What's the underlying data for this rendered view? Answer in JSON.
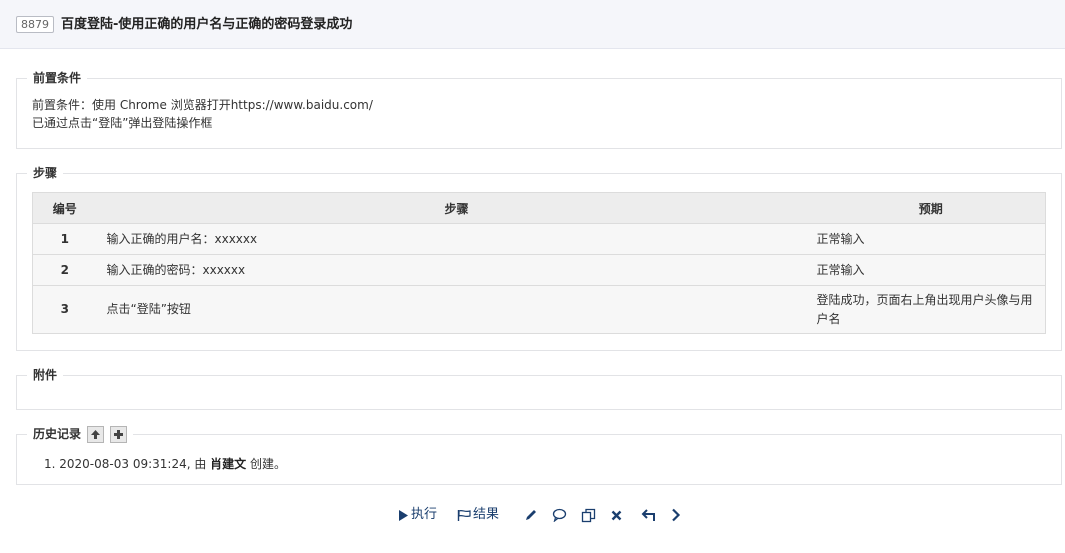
{
  "header": {
    "id": "8879",
    "title": "百度登陆-使用正确的用户名与正确的密码登录成功"
  },
  "precondition": {
    "legend": "前置条件",
    "lines": [
      "前置条件：使用 Chrome 浏览器打开https://www.baidu.com/",
      "已通过点击“登陆”弹出登陆操作框"
    ]
  },
  "steps": {
    "legend": "步骤",
    "headers": {
      "num": "编号",
      "step": "步骤",
      "expected": "预期"
    },
    "rows": [
      {
        "num": "1",
        "step": "输入正确的用户名：xxxxxx",
        "expected": "正常输入"
      },
      {
        "num": "2",
        "step": "输入正确的密码：xxxxxx",
        "expected": "正常输入"
      },
      {
        "num": "3",
        "step": "点击“登陆”按钮",
        "expected": "登陆成功，页面右上角出现用户头像与用户名"
      }
    ]
  },
  "files": {
    "legend": "附件"
  },
  "history": {
    "legend": "历史记录",
    "items": [
      {
        "prefix": "1. 2020-08-03 09:31:24, 由 ",
        "user": "肖建文",
        "suffix": " 创建。"
      }
    ]
  },
  "toolbar": {
    "run_label": "执行",
    "result_label": "结果",
    "icons": [
      "play-icon",
      "flag-icon",
      "pencil-icon",
      "comment-icon",
      "copy-icon",
      "close-icon",
      "back-icon",
      "next-icon"
    ],
    "accent_color": "#1a3e6e"
  }
}
